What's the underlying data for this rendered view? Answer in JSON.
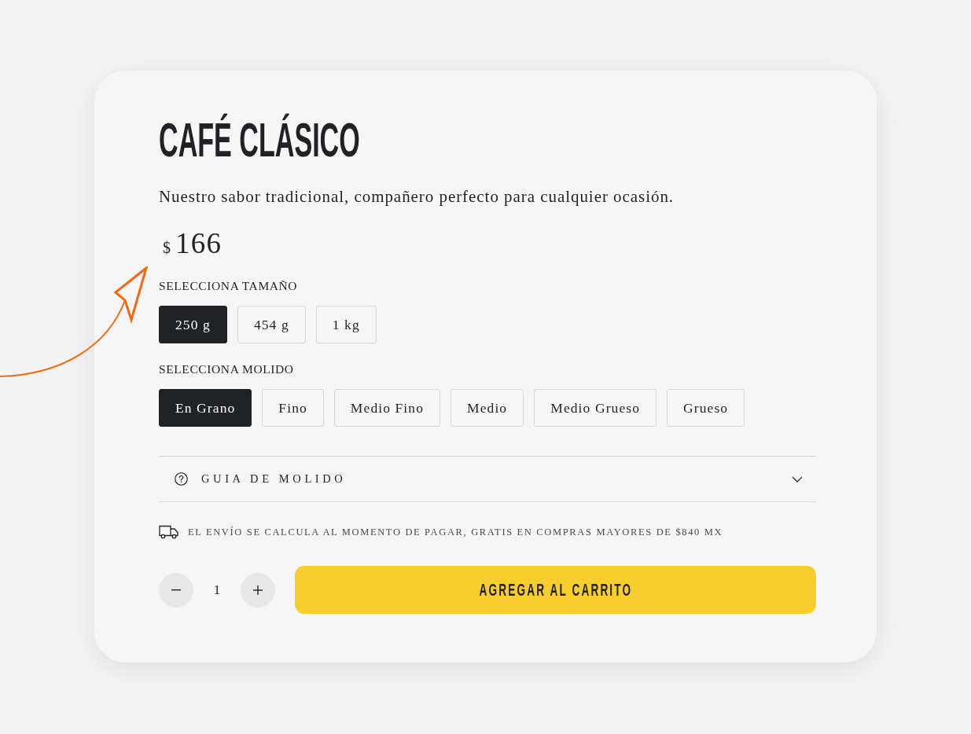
{
  "product": {
    "title": "CAFÉ CLÁSICO",
    "description": "Nuestro sabor tradicional, compañero perfecto para cualquier ocasión.",
    "price": {
      "currency": "$",
      "amount": "166"
    }
  },
  "size_selector": {
    "label": "SELECCIONA TAMAÑO",
    "options": [
      {
        "label": "250 g",
        "selected": true
      },
      {
        "label": "454 g",
        "selected": false
      },
      {
        "label": "1 kg",
        "selected": false
      }
    ]
  },
  "grind_selector": {
    "label": "SELECCIONA MOLIDO",
    "options": [
      {
        "label": "En Grano",
        "selected": true
      },
      {
        "label": "Fino",
        "selected": false
      },
      {
        "label": "Medio Fino",
        "selected": false
      },
      {
        "label": "Medio",
        "selected": false
      },
      {
        "label": "Medio Grueso",
        "selected": false
      },
      {
        "label": "Grueso",
        "selected": false
      }
    ]
  },
  "grind_guide": {
    "label": "GUIA DE MOLIDO",
    "expanded": false
  },
  "shipping_note": "EL ENVÍO SE CALCULA AL MOMENTO DE PAGAR, GRATIS EN COMPRAS MAYORES DE $840 MX",
  "quantity": {
    "value": "1"
  },
  "add_to_cart": "AGREGAR AL CARRITO"
}
